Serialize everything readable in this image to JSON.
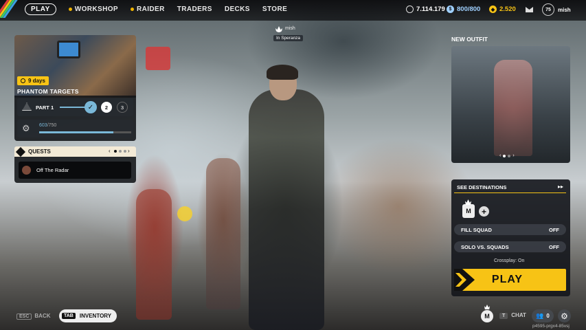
{
  "nav": {
    "play": "PLAY",
    "items": [
      "WORKSHOP",
      "RAIDER",
      "TRADERS",
      "DECKS",
      "STORE"
    ]
  },
  "currency": {
    "credits": "7.114.179",
    "cap": "800/800",
    "coins": "2.520"
  },
  "profile": {
    "level": "75",
    "name": "mish"
  },
  "center_player": {
    "name": "mish",
    "status": "In Speranza"
  },
  "event": {
    "timer": "9 days",
    "title": "PHANTOM TARGETS",
    "part_label": "PART 1",
    "steps": [
      "2",
      "3"
    ],
    "progress_value": "603",
    "progress_total": "/750",
    "progress_fraction": 0.804
  },
  "quests": {
    "title": "QUESTS",
    "item": "Off The Radar"
  },
  "outfit": {
    "title": "NEW OUTFIT"
  },
  "destinations": {
    "label": "SEE DESTINATIONS"
  },
  "squad": {
    "fill_label": "FILL SQUAD",
    "fill_state": "OFF",
    "solo_label": "SOLO VS. SQUADS",
    "solo_state": "OFF",
    "crossplay": "Crossplay: On"
  },
  "play_button": "PLAY",
  "bottom": {
    "esc_key": "ESC",
    "back": "BACK",
    "tab_key": "TAB",
    "inventory": "INVENTORY",
    "chat_key": "T",
    "chat": "CHAT",
    "friends_count": "0",
    "session_id": "p4595-prgx4-85vsj"
  },
  "colors": {
    "accent": "#f7c315",
    "panel": "#14161c",
    "progress": "#7ab8d8"
  }
}
